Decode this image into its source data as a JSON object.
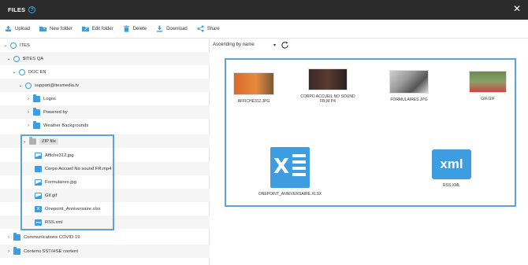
{
  "window": {
    "title": "FILES",
    "help_glyph": "?"
  },
  "toolbar": {
    "upload": "Upload",
    "new_folder": "New folder",
    "edit_folder": "Edit folder",
    "delete": "Delete",
    "download": "Download",
    "share": "Share"
  },
  "tree": {
    "root": "ITES",
    "sites": "$ITES QA",
    "doc": "DOC EN",
    "support": "support@itesmedia.tv",
    "logos": "Logos",
    "powered": "Powered by",
    "weather": "Weather Backgrounds",
    "zip": "ZIP file",
    "files": [
      "Affiche312.jpg",
      "Corpo Accueil No sound FR.mp4",
      "Formulaires.jpg",
      "Gif.gif",
      "Onepoint_Anniversaire.xlsx",
      "RSS.xml"
    ],
    "comms": "Communications COVID-19",
    "contenu": "Contenu SST/HSE content"
  },
  "sort": {
    "selected": "Ascending by name"
  },
  "grid": {
    "items": [
      "AFFICHE312.JPG",
      "CORPO ACCUEIL NO SOUND FR.M P4",
      "FORMULAIRES.JPG",
      "GIF.GIF",
      "ONEPOINT_ANNIVERSAIRE.XLSX",
      "RSS.XML"
    ],
    "xls_letter": "X",
    "xml_text": "xml"
  },
  "colors": {
    "accent": "#3d9de0",
    "highlight": "#5aa4d6",
    "titlebar": "#2b2b2b"
  }
}
